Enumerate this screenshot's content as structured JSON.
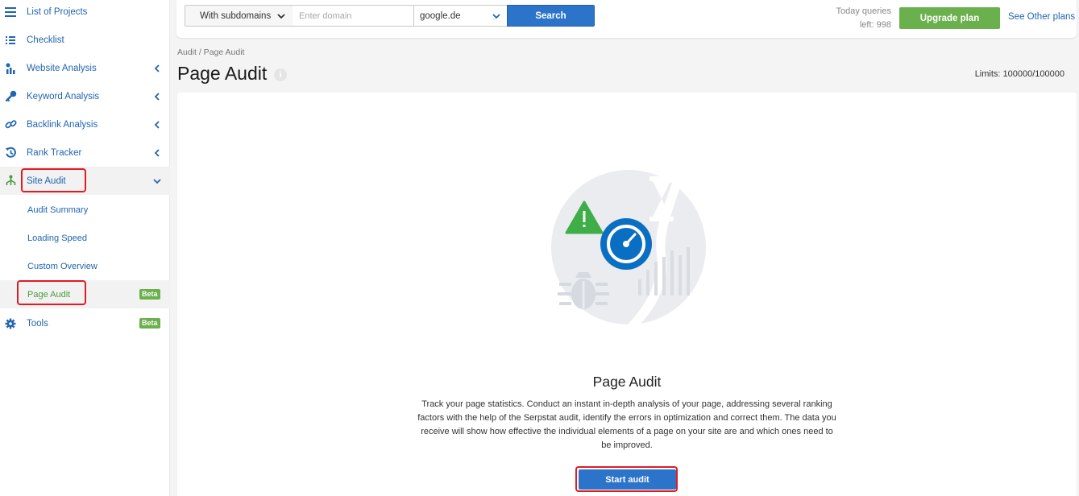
{
  "sidebar": {
    "items": [
      {
        "label": "List of Projects",
        "icon": "menu-icon"
      },
      {
        "label": "Checklist",
        "icon": "list-icon"
      },
      {
        "label": "Website Analysis",
        "icon": "chart-icon"
      },
      {
        "label": "Keyword Analysis",
        "icon": "key-icon"
      },
      {
        "label": "Backlink Analysis",
        "icon": "link-icon"
      },
      {
        "label": "Rank Tracker",
        "icon": "history-icon"
      },
      {
        "label": "Site Audit",
        "icon": "sitemap-icon"
      },
      {
        "label": "Tools",
        "icon": "gear-icon"
      }
    ],
    "sub_items": [
      {
        "label": "Audit Summary"
      },
      {
        "label": "Loading Speed"
      },
      {
        "label": "Custom Overview"
      },
      {
        "label": "Page Audit"
      }
    ],
    "badge": "Beta"
  },
  "topbar": {
    "subdomain_select": "With subdomains",
    "domain_placeholder": "Enter domain",
    "database_select": "google.de",
    "search_label": "Search",
    "queries_line1": "Today queries",
    "queries_line2": "left: 998",
    "upgrade_label": "Upgrade plan",
    "other_plans_label": "See Other plans"
  },
  "header": {
    "breadcrumb": "Audit / Page Audit",
    "title": "Page Audit",
    "info_glyph": "i",
    "limits": "Limits: 100000/100000"
  },
  "main": {
    "title": "Page Audit",
    "description": "Track your page statistics. Conduct an instant in-depth analysis of your page, addressing several ranking factors with the help of the Serpstat audit, identify the errors in optimization and correct them. The data you receive will show how effective the individual elements of a page on your site are and which ones need to be improved.",
    "start_label": "Start audit"
  },
  "colors": {
    "link_blue": "#2165b0",
    "primary_blue": "#2c74c9",
    "green": "#6ab04c",
    "highlight_red": "#e01b22",
    "icon_blue": "#0a6fc2"
  }
}
